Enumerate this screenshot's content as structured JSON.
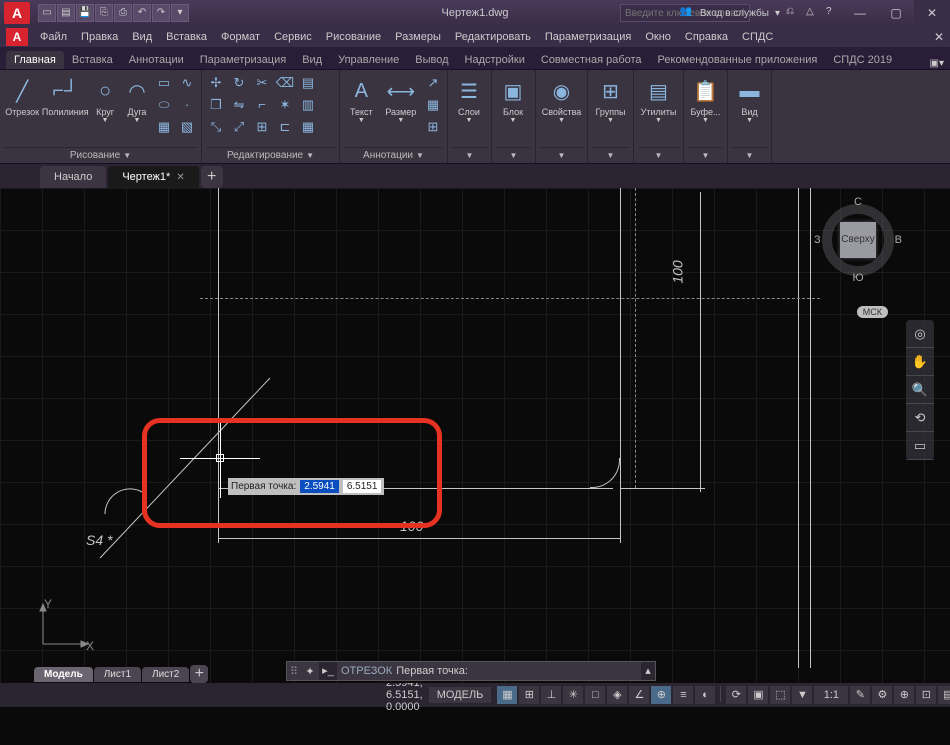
{
  "title": "Чертеж1.dwg",
  "search_placeholder": "Введите ключевое слово/фразу",
  "signin": "Вход в службы",
  "menus": [
    "Файл",
    "Правка",
    "Вид",
    "Вставка",
    "Формат",
    "Сервис",
    "Рисование",
    "Размеры",
    "Редактировать",
    "Параметризация",
    "Окно",
    "Справка",
    "СПДС"
  ],
  "ribbon_tabs": [
    "Главная",
    "Вставка",
    "Аннотации",
    "Параметризация",
    "Вид",
    "Управление",
    "Вывод",
    "Надстройки",
    "Совместная работа",
    "Рекомендованные приложения",
    "СПДС 2019"
  ],
  "active_ribbon_tab": 0,
  "panels": {
    "draw": {
      "label": "Рисование",
      "line": "Отрезок",
      "polyline": "Полилиния",
      "circle": "Круг",
      "arc": "Дуга"
    },
    "modify": {
      "label": "Редактирование"
    },
    "annot": {
      "label": "Аннотации",
      "text": "Текст",
      "dim": "Размер"
    },
    "layers": {
      "label": "Слои"
    },
    "block": {
      "label": "Блок"
    },
    "props": {
      "label": "Свойства"
    },
    "groups": {
      "label": "Группы"
    },
    "utils": {
      "label": "Утилиты"
    },
    "clipboard": {
      "label": "Буфе..."
    },
    "view": {
      "label": "Вид"
    }
  },
  "doc_tabs": {
    "start": "Начало",
    "active": "Чертеж1*"
  },
  "dynamic_input": {
    "label": "Первая точка:",
    "x": "2.5941",
    "y": "6.5151"
  },
  "dims": {
    "h": "100",
    "v": "100",
    "s4": "S4 *"
  },
  "viewcube": {
    "top": "Сверху",
    "n": "С",
    "s": "Ю",
    "e": "В",
    "w": "З"
  },
  "wcs": "МСК",
  "layout_tabs": [
    "Модель",
    "Лист1",
    "Лист2"
  ],
  "command": {
    "name": "ОТРЕЗОК",
    "prompt": "Первая точка:"
  },
  "status": {
    "coords": "2.5941, 6.5151, 0.0000",
    "mode": "МОДЕЛЬ",
    "ratio": "1:1",
    "ucs": {
      "x_label": "X",
      "y_label": "Y"
    }
  }
}
